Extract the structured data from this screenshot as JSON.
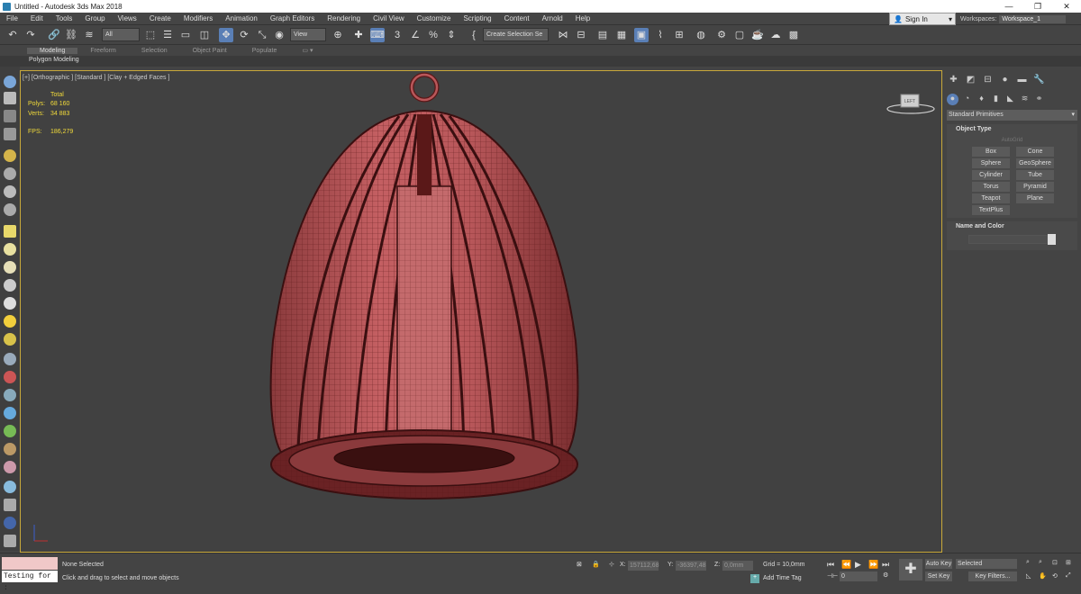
{
  "window": {
    "title": "Untitled - Autodesk 3ds Max 2018",
    "minimize": "—",
    "maximize": "❐",
    "close": "✕"
  },
  "menu": [
    "File",
    "Edit",
    "Tools",
    "Group",
    "Views",
    "Create",
    "Modifiers",
    "Animation",
    "Graph Editors",
    "Rendering",
    "Civil View",
    "Customize",
    "Scripting",
    "Content",
    "Arnold",
    "Help"
  ],
  "signin": {
    "label": "Sign In"
  },
  "workspaces": {
    "label": "Workspaces:",
    "value": "Workspace_1"
  },
  "toolbar": {
    "selection_filter": "All",
    "ref_coord": "View",
    "named_selection": "Create Selection Se"
  },
  "ribbon": {
    "tabs": [
      "Modeling",
      "Freeform",
      "Selection",
      "Object Paint",
      "Populate"
    ],
    "active": "Modeling",
    "sub": "Polygon Modeling"
  },
  "viewport": {
    "label": "[+] [Orthographic ] [Standard ] [Clay + Edged Faces ]",
    "stats_total": "Total",
    "polys_label": "Polys:",
    "polys_value": "68 160",
    "verts_label": "Verts:",
    "verts_value": "34 883",
    "fps_label": "FPS:",
    "fps_value": "186,279",
    "viewcube": "LEFT",
    "colors": {
      "mesh": "#b8575a",
      "wire": "#5a1818",
      "border": "#c9a93a"
    }
  },
  "command_panel": {
    "dropdown": "Standard Primitives",
    "object_type": {
      "header": "Object Type",
      "autogrid": "AutoGrid",
      "buttons": [
        "Box",
        "Cone",
        "Sphere",
        "GeoSphere",
        "Cylinder",
        "Tube",
        "Torus",
        "Pyramid",
        "Teapot",
        "Plane",
        "TextPlus"
      ]
    },
    "name_color": {
      "header": "Name and Color"
    }
  },
  "status": {
    "maxscript": "Testing for :",
    "selection": "None Selected",
    "prompt": "Click and drag to select and move objects",
    "x_label": "X:",
    "x": "157112,68",
    "y_label": "Y:",
    "y": "-36397,48",
    "z_label": "Z:",
    "z": "0,0mm",
    "grid": "Grid = 10,0mm",
    "add_time_tag": "Add Time Tag",
    "frame": "0",
    "autokey": "Auto Key",
    "setkey": "Set Key",
    "selected": "Selected",
    "keyfilters": "Key Filters..."
  }
}
